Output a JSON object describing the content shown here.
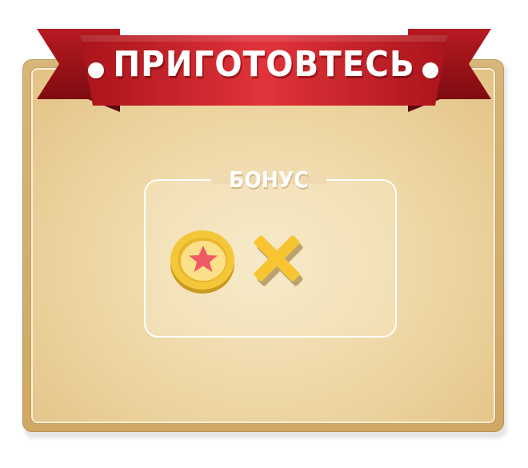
{
  "banner": {
    "title": "ПРИГОТОВТЕСЬ"
  },
  "bonus": {
    "label": "БОНУС",
    "items": [
      {
        "icon": "coin-star-icon"
      },
      {
        "icon": "cross-icon"
      }
    ]
  },
  "colors": {
    "ribbon_red": "#d3222a",
    "ribbon_dark": "#8e0f14",
    "panel_gold": "#d6b679",
    "panel_light": "#f6e7c4",
    "coin_yellow": "#f7cf3d",
    "star_red": "#f05a64",
    "cross_yellow": "#f7c531"
  }
}
